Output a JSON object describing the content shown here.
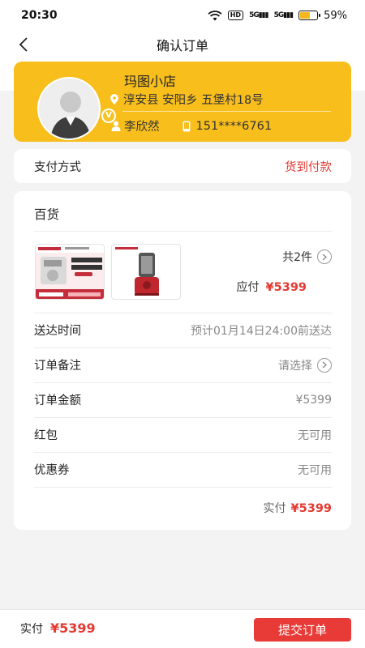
{
  "status_bar": {
    "time": "20:30",
    "hd": "HD",
    "signal1": "5G",
    "signal2": "5G",
    "battery": "59%",
    "battery_level": 0.59
  },
  "nav": {
    "title": "确认订单"
  },
  "address": {
    "store_name": "玛图小店",
    "address_line": "淳安县 安阳乡 五堡村18号",
    "contact_name": "李欣然",
    "phone": "151****6761",
    "badge": "V"
  },
  "payment": {
    "label": "支付方式",
    "value": "货到付款"
  },
  "order": {
    "section_title": "百货",
    "products": [
      {
        "brand": "KitchenAid",
        "caption": "全属绞肉器升级耐用",
        "store": "天猫官方旗舰店"
      },
      {
        "brand": "KitchenAid"
      }
    ],
    "quantity": "共2件",
    "due_label": "应付",
    "due_value": "¥5399",
    "rows": [
      {
        "label": "送达时间",
        "value": "预计01月14日24:00前送达"
      },
      {
        "label": "订单备注",
        "value": "请选择"
      },
      {
        "label": "订单金额",
        "value": "¥5399"
      },
      {
        "label": "红包",
        "value": "无可用"
      },
      {
        "label": "优惠券",
        "value": "无可用"
      }
    ],
    "paid_label": "实付",
    "paid_value": "¥5399"
  },
  "bottom": {
    "paid_label": "实付",
    "paid_value": "¥5399",
    "submit_label": "提交订单"
  },
  "colors": {
    "accent_red": "#e33a32",
    "card_yellow": "#f8be1c",
    "submit_red": "#e83a37"
  }
}
